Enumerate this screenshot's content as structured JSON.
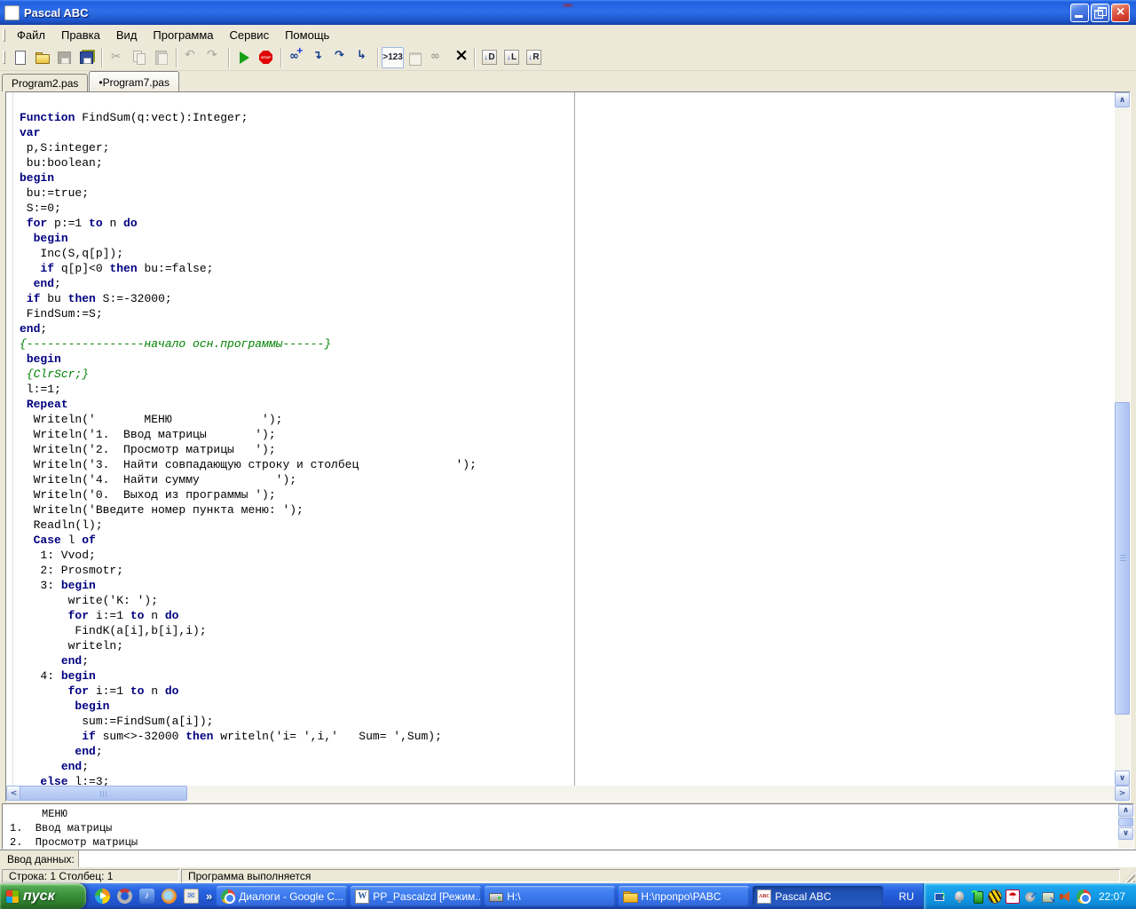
{
  "window": {
    "title": "Pascal ABC"
  },
  "menu": {
    "items": [
      "Файл",
      "Правка",
      "Вид",
      "Программа",
      "Сервис",
      "Помощь"
    ]
  },
  "toolbar": {
    "groups": [
      [
        {
          "name": "new-file"
        },
        {
          "name": "open-file"
        },
        {
          "name": "save-file",
          "disabled": true
        },
        {
          "name": "save-all"
        }
      ],
      [
        {
          "name": "cut",
          "disabled": true
        },
        {
          "name": "copy",
          "disabled": true
        },
        {
          "name": "paste",
          "disabled": true
        }
      ],
      [
        {
          "name": "undo",
          "disabled": true
        },
        {
          "name": "redo",
          "disabled": true
        }
      ],
      [
        {
          "name": "run"
        },
        {
          "name": "stop"
        }
      ],
      [
        {
          "name": "add-watch"
        },
        {
          "name": "step-into"
        },
        {
          "name": "step-over"
        },
        {
          "name": "step-out"
        }
      ],
      [
        {
          "name": "int-format",
          "label": ">123",
          "pressed": true
        },
        {
          "name": "console-window",
          "disabled": true
        },
        {
          "name": "watch-window",
          "disabled": true
        },
        {
          "name": "close-window"
        }
      ],
      [
        {
          "name": "goto-d",
          "label": "D"
        },
        {
          "name": "goto-l",
          "label": "L"
        },
        {
          "name": "goto-r",
          "label": "R"
        }
      ]
    ]
  },
  "tabs": [
    {
      "label": "Program2.pas",
      "active": false
    },
    {
      "label": "•Program7.pas",
      "active": true
    }
  ],
  "editor": {
    "lines": [
      [
        [
          "k",
          "Function"
        ],
        [
          "p",
          " FindSum(q:vect):Integer;"
        ]
      ],
      [
        [
          "k",
          "var"
        ]
      ],
      [
        [
          "p",
          " p,S:integer;"
        ]
      ],
      [
        [
          "p",
          " bu:boolean;"
        ]
      ],
      [
        [
          "k",
          "begin"
        ]
      ],
      [
        [
          "p",
          " bu:=true;"
        ]
      ],
      [
        [
          "p",
          " S:=0;"
        ]
      ],
      [
        [
          "p",
          " "
        ],
        [
          "k",
          "for"
        ],
        [
          "p",
          " p:=1 "
        ],
        [
          "k",
          "to"
        ],
        [
          "p",
          " n "
        ],
        [
          "k",
          "do"
        ]
      ],
      [
        [
          "p",
          "  "
        ],
        [
          "k",
          "begin"
        ]
      ],
      [
        [
          "p",
          "   Inc(S,q[p]);"
        ]
      ],
      [
        [
          "p",
          "   "
        ],
        [
          "k",
          "if"
        ],
        [
          "p",
          " q[p]<0 "
        ],
        [
          "k",
          "then"
        ],
        [
          "p",
          " bu:=false;"
        ]
      ],
      [
        [
          "p",
          "  "
        ],
        [
          "k",
          "end"
        ],
        [
          "p",
          ";"
        ]
      ],
      [
        [
          "p",
          " "
        ],
        [
          "k",
          "if"
        ],
        [
          "p",
          " bu "
        ],
        [
          "k",
          "then"
        ],
        [
          "p",
          " S:=-32000;"
        ]
      ],
      [
        [
          "p",
          " FindSum:=S;"
        ]
      ],
      [
        [
          "k",
          "end"
        ],
        [
          "p",
          ";"
        ]
      ],
      [
        [
          "c",
          "{-----------------начало осн.программы------}"
        ]
      ],
      [
        [
          "p",
          " "
        ],
        [
          "k",
          "begin"
        ]
      ],
      [
        [
          "p",
          " "
        ],
        [
          "c",
          "{ClrScr;}"
        ]
      ],
      [
        [
          "p",
          " l:=1;"
        ]
      ],
      [
        [
          "p",
          " "
        ],
        [
          "k",
          "Repeat"
        ]
      ],
      [
        [
          "p",
          "  Writeln('       МЕНЮ             ');"
        ]
      ],
      [
        [
          "p",
          "  Writeln('1.  Ввод матрицы       ');"
        ]
      ],
      [
        [
          "p",
          "  Writeln('2.  Просмотр матрицы   ');"
        ]
      ],
      [
        [
          "p",
          "  Writeln('3.  Найти совпадающую строку и столбец              ');"
        ]
      ],
      [
        [
          "p",
          "  Writeln('4.  Найти сумму           ');"
        ]
      ],
      [
        [
          "p",
          "  Writeln('0.  Выход из программы ');"
        ]
      ],
      [
        [
          "p",
          "  Writeln('Введите номер пункта меню: ');"
        ]
      ],
      [
        [
          "p",
          "  Readln(l);"
        ]
      ],
      [
        [
          "p",
          "  "
        ],
        [
          "k",
          "Case"
        ],
        [
          "p",
          " l "
        ],
        [
          "k",
          "of"
        ]
      ],
      [
        [
          "p",
          "   1: Vvod;"
        ]
      ],
      [
        [
          "p",
          "   2: Prosmotr;"
        ]
      ],
      [
        [
          "p",
          "   3: "
        ],
        [
          "k",
          "begin"
        ]
      ],
      [
        [
          "p",
          "       write('K: ');"
        ]
      ],
      [
        [
          "p",
          "       "
        ],
        [
          "k",
          "for"
        ],
        [
          "p",
          " i:=1 "
        ],
        [
          "k",
          "to"
        ],
        [
          "p",
          " n "
        ],
        [
          "k",
          "do"
        ]
      ],
      [
        [
          "p",
          "        FindK(a[i],b[i],i);"
        ]
      ],
      [
        [
          "p",
          "       writeln;"
        ]
      ],
      [
        [
          "p",
          "      "
        ],
        [
          "k",
          "end"
        ],
        [
          "p",
          ";"
        ]
      ],
      [
        [
          "p",
          "   4: "
        ],
        [
          "k",
          "begin"
        ]
      ],
      [
        [
          "p",
          "       "
        ],
        [
          "k",
          "for"
        ],
        [
          "p",
          " i:=1 "
        ],
        [
          "k",
          "to"
        ],
        [
          "p",
          " n "
        ],
        [
          "k",
          "do"
        ]
      ],
      [
        [
          "p",
          "        "
        ],
        [
          "k",
          "begin"
        ]
      ],
      [
        [
          "p",
          "         sum:=FindSum(a[i]);"
        ]
      ],
      [
        [
          "p",
          "         "
        ],
        [
          "k",
          "if"
        ],
        [
          "p",
          " sum<>-32000 "
        ],
        [
          "k",
          "then"
        ],
        [
          "p",
          " writeln('i= ',i,'   Sum= ',Sum);"
        ]
      ],
      [
        [
          "p",
          "        "
        ],
        [
          "k",
          "end"
        ],
        [
          "p",
          ";"
        ]
      ],
      [
        [
          "p",
          "      "
        ],
        [
          "k",
          "end"
        ],
        [
          "p",
          ";"
        ]
      ],
      [
        [
          "p",
          "   "
        ],
        [
          "k",
          "else"
        ],
        [
          "p",
          " l:=3;"
        ]
      ]
    ]
  },
  "output": {
    "lines": [
      "     МЕНЮ",
      "1.  Ввод матрицы",
      "2.  Просмотр матрицы"
    ]
  },
  "input_row": {
    "label": "Ввод данных:",
    "value": ""
  },
  "status": {
    "position": "Строка: 1   Столбец: 1",
    "message": "Программа выполняется"
  },
  "taskbar": {
    "start_label": "пуск",
    "quick_launch": [
      "media-player",
      "app-ring",
      "music-app",
      "firefox",
      "mail-app"
    ],
    "overflow_chevron": "»",
    "buttons": [
      {
        "label": "Диалоги - Google C...",
        "icon": "chrome",
        "active": false
      },
      {
        "label": "PP_Pascalzd [Режим...",
        "icon": "word",
        "active": false
      },
      {
        "label": "H:\\",
        "icon": "drive",
        "active": false
      },
      {
        "label": "H:\\пропро\\PABC",
        "icon": "folder",
        "active": false
      },
      {
        "label": "Pascal ABC",
        "icon": "pascal",
        "active": true
      }
    ],
    "language": "RU",
    "tray": [
      "network-display",
      "bell",
      "usb-modem",
      "beeline",
      "antivirus",
      "audio-device",
      "updater",
      "volume",
      "chrome"
    ],
    "clock": "22:07"
  }
}
